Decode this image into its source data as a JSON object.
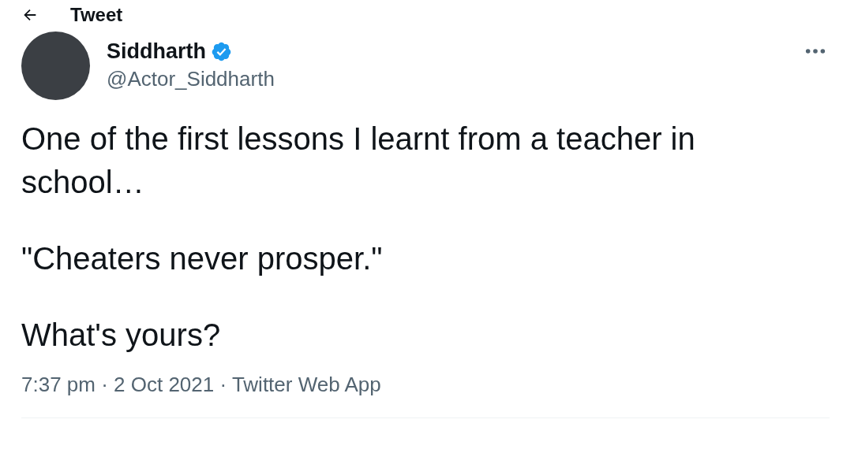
{
  "header": {
    "title": "Tweet"
  },
  "author": {
    "name": "Siddharth",
    "verified": true,
    "handle": "@Actor_Siddharth"
  },
  "tweet": {
    "paragraphs": [
      "One of the first lessons I learnt from a teacher in school…",
      "\"Cheaters never prosper.\"",
      "What's yours?"
    ]
  },
  "meta": "7:37 pm · 2 Oct 2021 · Twitter Web App"
}
